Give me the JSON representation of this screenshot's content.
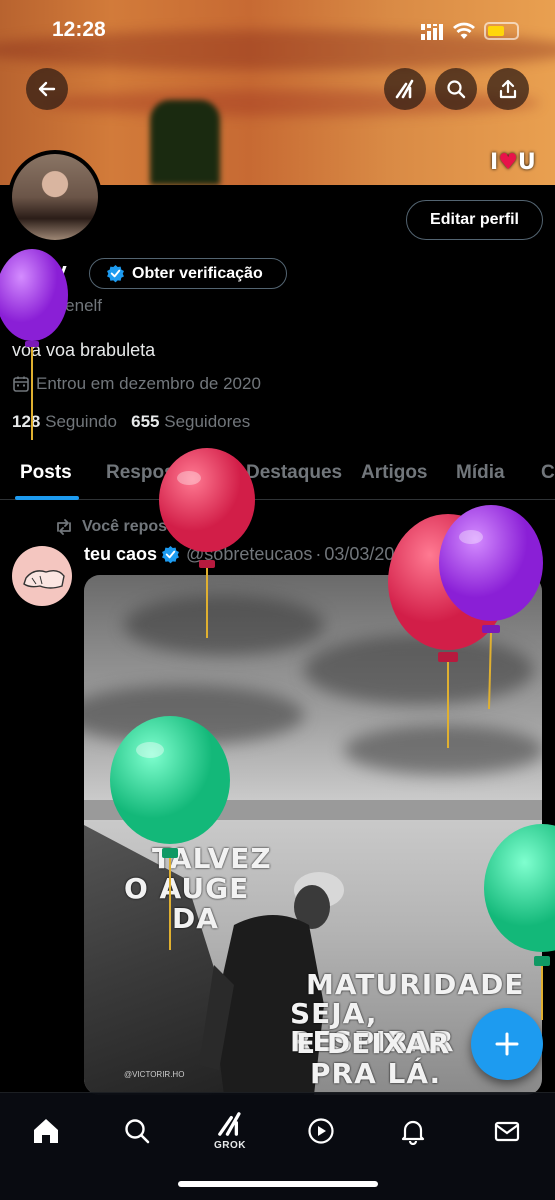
{
  "status_bar": {
    "time": "12:28"
  },
  "banner": {
    "sticker_text": "I ♥ U"
  },
  "header": {
    "edit_profile_label": "Editar perfil"
  },
  "profile": {
    "name": "shay",
    "verify_label": "Obter verificação",
    "handle": "@shayenelf",
    "bio": "voa voa brabuleta",
    "joined": "Entrou em dezembro de 2020",
    "following_count": "128",
    "following_label": "Seguindo",
    "followers_count": "655",
    "followers_label": "Seguidores"
  },
  "tabs": [
    {
      "label": "Posts",
      "active": true
    },
    {
      "label": "Respostas"
    },
    {
      "label": "Destaques"
    },
    {
      "label": "Artigos"
    },
    {
      "label": "Mídia"
    },
    {
      "label": "C"
    }
  ],
  "post": {
    "repost_label": "Você repostou",
    "author_name": "teu caos",
    "author_handle": "@sobreteucaos",
    "separator": "·",
    "date": "03/03/2025",
    "more": "···",
    "image_text": {
      "line1": "TALVEZ",
      "line2": "O AUGE",
      "line3": "DA",
      "line4": "MATURIDADE",
      "line5": "SEJA, RESPIRAR",
      "line6": "E DEIXAR",
      "line7": "PRA LÁ.",
      "credit": "@VICTORIR.HO"
    }
  },
  "bottom_nav": {
    "grok_label": "GROK"
  },
  "colors": {
    "accent": "#1d9bf0",
    "background": "#000000",
    "balloon_purple": "#a339e6",
    "balloon_red": "#e33a5c",
    "balloon_green": "#2fd49a"
  }
}
